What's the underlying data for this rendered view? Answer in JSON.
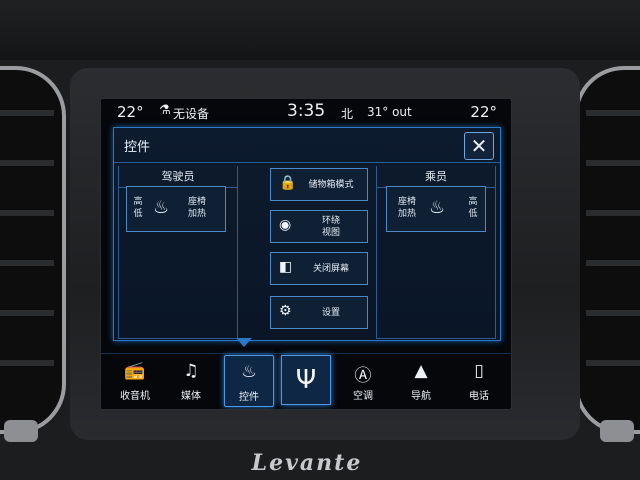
{
  "status": {
    "temp_left": "22°",
    "usb_icon": "usb-icon",
    "usb_label": "无设备",
    "time": "3:35",
    "compass": "北",
    "outside_temp": "31° out",
    "temp_right": "22°"
  },
  "panel": {
    "title": "控件",
    "close_label": "✕",
    "driver": {
      "title": "驾驶员",
      "level_high": "高",
      "level_low": "低",
      "seat_label_1": "座椅",
      "seat_label_2": "加热"
    },
    "passenger": {
      "title": "乘员",
      "level_high": "高",
      "level_low": "低",
      "seat_label_1": "座椅",
      "seat_label_2": "加热"
    },
    "buttons": [
      {
        "label": "储物箱模式",
        "icon": "lock-icon"
      },
      {
        "label": "环绕\n视图",
        "icon": "camera-icon"
      },
      {
        "label": "关闭屏幕",
        "icon": "screen-off-icon"
      },
      {
        "label": "设置",
        "icon": "gears-icon"
      }
    ]
  },
  "nav": {
    "items": [
      {
        "label": "收音机",
        "icon": "radio-icon"
      },
      {
        "label": "媒体",
        "icon": "media-icon"
      },
      {
        "label": "控件",
        "icon": "seat-control-icon",
        "active": true
      },
      {
        "label": "",
        "icon": "trident-home-icon"
      },
      {
        "label": "空调",
        "icon": "climate-icon"
      },
      {
        "label": "导航",
        "icon": "navigation-icon"
      },
      {
        "label": "电话",
        "icon": "phone-icon"
      }
    ]
  },
  "brand": "Levante",
  "colors": {
    "accent": "#2c78c4",
    "panel_bg": "#0d1b2e",
    "screen_bg": "#05070b"
  }
}
